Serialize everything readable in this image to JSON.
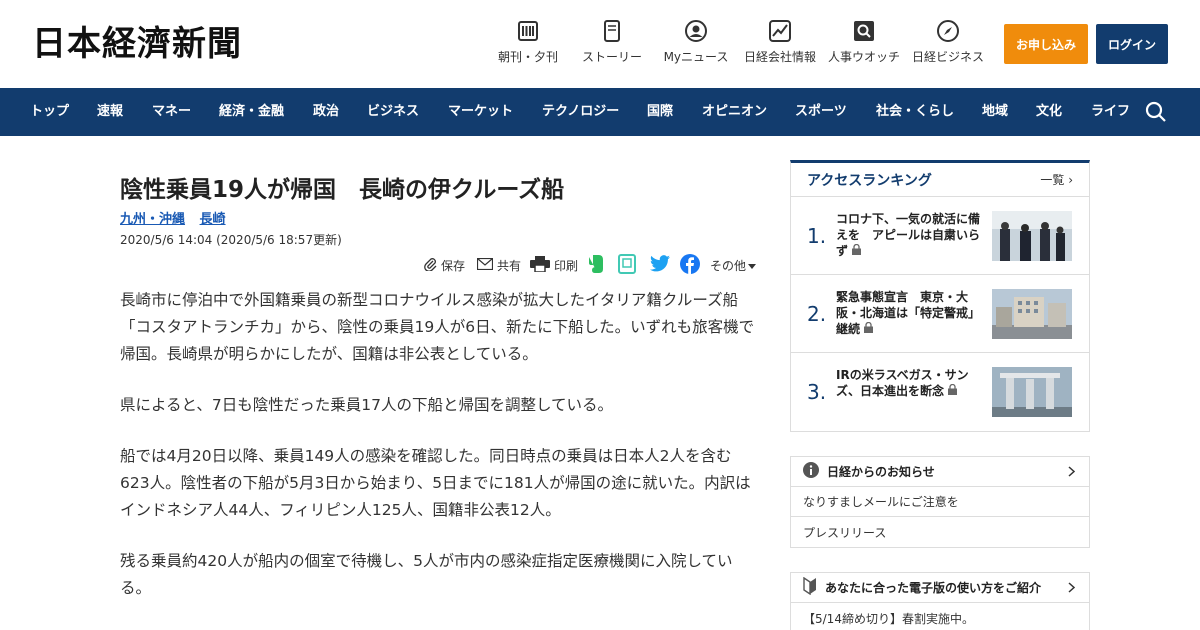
{
  "header": {
    "logo": "日本経濟新聞",
    "nav": [
      {
        "label": "朝刊・夕刊",
        "icon": "newspaper-icon"
      },
      {
        "label": "ストーリー",
        "icon": "phone-icon"
      },
      {
        "label": "Myニュース",
        "icon": "user-icon"
      },
      {
        "label": "日経会社情報",
        "icon": "chart-icon"
      },
      {
        "label": "人事ウオッチ",
        "icon": "magnifier-icon"
      },
      {
        "label": "日経ビジネス",
        "icon": "compass-icon"
      }
    ],
    "subscribe_label": "お申し込み",
    "login_label": "ログイン"
  },
  "navbar": {
    "items": [
      "トップ",
      "速報",
      "マネー",
      "経済・金融",
      "政治",
      "ビジネス",
      "マーケット",
      "テクノロジー",
      "国際",
      "オピニオン",
      "スポーツ",
      "社会・くらし",
      "地域",
      "文化",
      "ライフ"
    ],
    "bg_color": "#123c6e"
  },
  "article": {
    "title": "陰性乗員19人が帰国　長崎の伊クルーズ船",
    "tags": [
      "九州・沖縄",
      "長崎"
    ],
    "date": "2020/5/6 14:04 (2020/5/6 18:57更新)",
    "tools": {
      "save": "保存",
      "share": "共有",
      "print": "印刷",
      "more": "その他"
    },
    "paragraphs": [
      "長崎市に停泊中で外国籍乗員の新型コロナウイルス感染が拡大したイタリア籍クルーズ船「コスタアトランチカ」から、陰性の乗員19人が6日、新たに下船した。いずれも旅客機で帰国。長崎県が明らかにしたが、国籍は非公表としている。",
      "県によると、7日も陰性だった乗員17人の下船と帰国を調整している。",
      "船では4月20日以降、乗員149人の感染を確認した。同日時点の乗員は日本人2人を含む623人。陰性者の下船が5月3日から始まり、5日までに181人が帰国の途に就いた。内訳はインドネシア人44人、フィリピン人125人、国籍非公表12人。",
      "残る乗員約420人が船内の個室で待機し、5人が市内の感染症指定医療機関に入院している。"
    ]
  },
  "sidebar": {
    "ranking": {
      "title": "アクセスランキング",
      "more": "一覧",
      "items": [
        {
          "num": "1.",
          "text": "コロナ下、一気の就活に備えを　アピールは自粛いらず"
        },
        {
          "num": "2.",
          "text": "緊急事態宣言　東京・大阪・北海道は「特定警戒」継続"
        },
        {
          "num": "3.",
          "text": "IRの米ラスベガス・サンズ、日本進出を断念"
        }
      ]
    },
    "notice": {
      "title": "日経からのお知らせ",
      "items": [
        "なりすましメールにご注意を",
        "プレスリリース"
      ]
    },
    "digital": {
      "title": "あなたに合った電子版の使い方をご紹介",
      "items": [
        "【5/14締め切り】春割実施中。"
      ]
    }
  }
}
